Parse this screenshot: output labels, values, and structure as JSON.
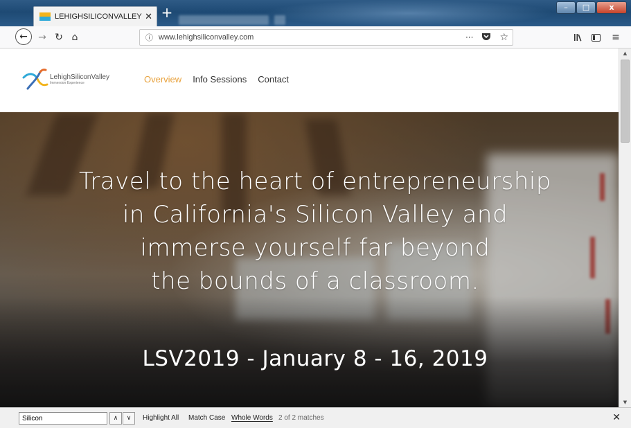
{
  "browser": {
    "tab_title": "LEHIGHSILICONVALLEY - Overview",
    "tab_close": "✕",
    "new_tab": "+",
    "window_controls": {
      "minimize": "–",
      "maximize": "□",
      "close": "x"
    },
    "url": "www.lehighsiliconvalley.com",
    "url_more": "···",
    "icons": [
      "back-arrow-icon",
      "forward-arrow-icon",
      "reload-icon",
      "home-icon",
      "info-icon",
      "pocket-icon",
      "bookmark-star-icon",
      "library-icon",
      "sidebar-icon",
      "menu-icon"
    ]
  },
  "site": {
    "logo_name": "LehighSiliconValley",
    "logo_sub": "Immersion Experience",
    "nav": [
      {
        "label": "Overview",
        "active": true
      },
      {
        "label": "Info Sessions",
        "active": false
      },
      {
        "label": "Contact",
        "active": false
      }
    ],
    "accent_color": "#e8a23d",
    "hero": {
      "heading_lines": [
        "Travel to the heart of entrepreneurship",
        "in California's Silicon Valley and",
        "immerse yourself far beyond",
        "the bounds of a classroom."
      ],
      "date": "LSV2019 - January 8 - 16, 2019"
    }
  },
  "findbar": {
    "query": "Silicon",
    "highlight_all": "Highlight All",
    "match_case": "Match Case",
    "whole_words": "Whole Words",
    "status": "2 of 2 matches",
    "close": "✕"
  }
}
